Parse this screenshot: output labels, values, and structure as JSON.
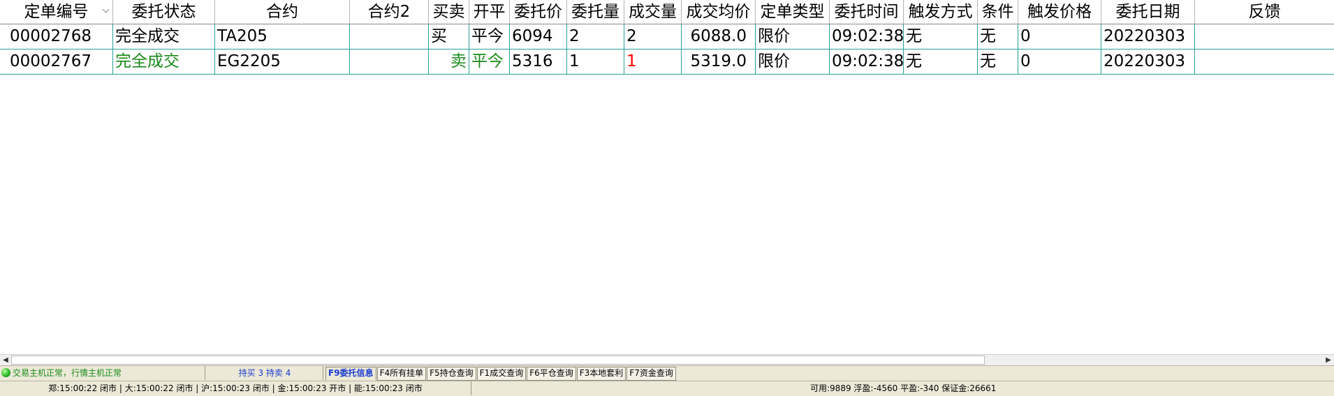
{
  "table": {
    "headers": [
      "定单编号",
      "委托状态",
      "合约",
      "合约2",
      "买卖",
      "开平",
      "委托价",
      "委托量",
      "成交量",
      "成交均价",
      "定单类型",
      "委托时间",
      "触发方式",
      "条件",
      "触发价格",
      "委托日期",
      "反馈"
    ],
    "rows": [
      [
        "00002768",
        "完全成交",
        "TA205",
        "",
        "买",
        "平今",
        "6094",
        "2",
        "2",
        "6088.0",
        "限价",
        "09:02:38",
        "无",
        "无",
        "0",
        "20220303",
        ""
      ],
      [
        "00002767",
        "完全成交",
        "EG2205",
        "",
        "卖",
        "平今",
        "5316",
        "1",
        "1",
        "5319.0",
        "限价",
        "09:02:38",
        "无",
        "无",
        "0",
        "20220303",
        ""
      ]
    ]
  },
  "colors": {
    "sell": "#178a17",
    "partial_fill": "#ff0000",
    "grid_line": "#2aa09a",
    "status_bar": "#ece9d8",
    "active_tab": "#1a3bd0"
  },
  "status": {
    "host": "交易主机正常，行情主机正常",
    "hold": "持买 3  持卖 4"
  },
  "tabs": [
    "F9委托信息",
    "F4所有挂单",
    "F5持仓查询",
    "F1成交查询",
    "F6平仓查询",
    "F3本地套利",
    "F7资金查询"
  ],
  "exchanges": "郑:15:00:22 闭市 | 大:15:00:22 闭市 | 沪:15:00:23 闭市 | 金:15:00:23 开市 | 能:15:00:23 闭市",
  "funds": "可用:9889 浮盈:-4560 平盈:-340 保证金:26661",
  "icons": {
    "sort": "sort-indicator-icon",
    "scroll_left": "arrow-left-icon",
    "scroll_right": "arrow-right-icon",
    "host_status": "status-light-icon"
  }
}
